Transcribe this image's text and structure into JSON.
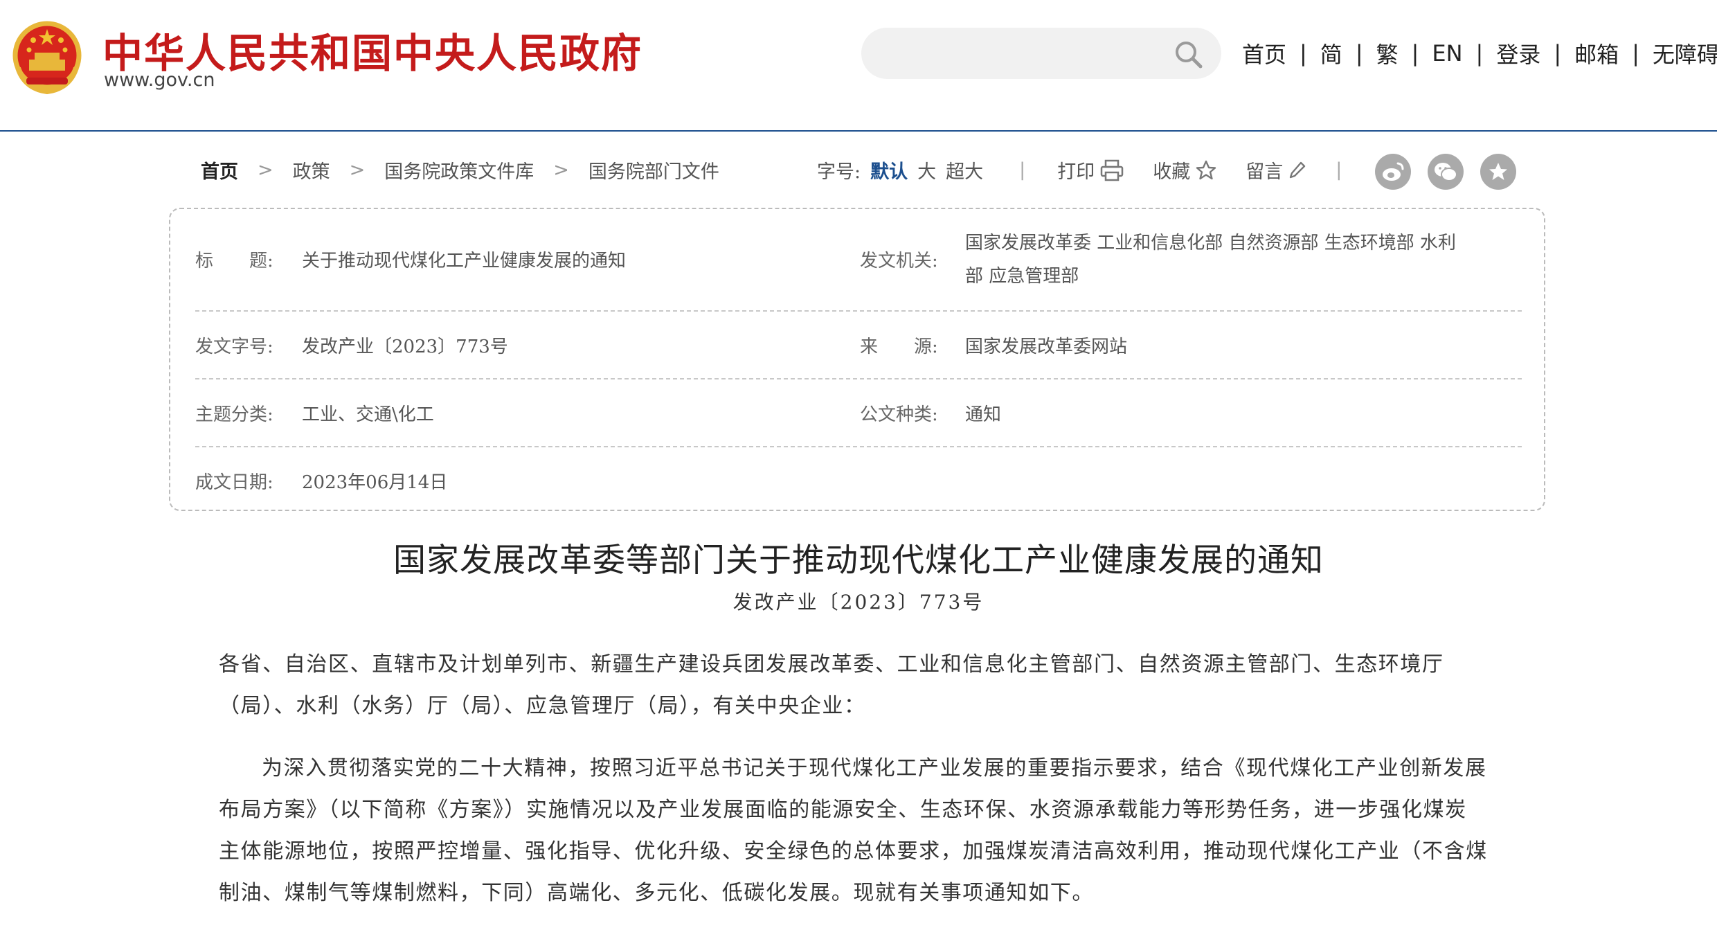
{
  "header": {
    "site_title": "中华人民共和国中央人民政府",
    "site_url": "www.gov.cn",
    "search_placeholder": "",
    "nav": [
      "首页",
      "简",
      "繁",
      "EN",
      "登录",
      "邮箱",
      "无障碍"
    ],
    "colors": {
      "brand_red": "#c41b1b",
      "accent_blue": "#1c4f8e"
    }
  },
  "breadcrumb": [
    "首页",
    "政策",
    "国务院政策文件库",
    "国务院部门文件"
  ],
  "toolbar": {
    "font_size_label": "字号:",
    "font_sizes": [
      "默认",
      "大",
      "超大"
    ],
    "selected_font_size": "默认",
    "print_label": "打印",
    "favorite_label": "收藏",
    "comment_label": "留言",
    "share_icons": [
      "weibo-icon",
      "wechat-icon",
      "star-icon"
    ]
  },
  "meta": {
    "title_label": "标　　题:",
    "title_value": "关于推动现代煤化工产业健康发展的通知",
    "issuer_label": "发文机关:",
    "issuer_line1": "国家发展改革委 工业和信息化部 自然资源部 生态环境部 水利",
    "issuer_line2": "部 应急管理部",
    "docno_label": "发文字号:",
    "docno_value": "发改产业〔2023〕773号",
    "source_label": "来　　源:",
    "source_value": "国家发展改革委网站",
    "topic_label": "主题分类:",
    "topic_value": "工业、交通\\化工",
    "doctype_label": "公文种类:",
    "doctype_value": "通知",
    "date_label": "成文日期:",
    "date_value": "2023年06月14日"
  },
  "article": {
    "title": "国家发展改革委等部门关于推动现代煤化工产业健康发展的通知",
    "doc_number": "发改产业〔2023〕773号",
    "addressee_line1": "各省、自治区、直辖市及计划单列市、新疆生产建设兵团发展改革委、工业和信息化主管部门、自然资源主管部门、生态环境厅",
    "addressee_line2": "（局）、水利（水务）厅（局）、应急管理厅（局），有关中央企业：",
    "body_line1": "为深入贯彻落实党的二十大精神，按照习近平总书记关于现代煤化工产业发展的重要指示要求，结合《现代煤化工产业创新发展",
    "body_line2": "布局方案》（以下简称《方案》）实施情况以及产业发展面临的能源安全、生态环保、水资源承载能力等形势任务，进一步强化煤炭",
    "body_line3": "主体能源地位，按照严控增量、强化指导、优化升级、安全绿色的总体要求，加强煤炭清洁高效利用，推动现代煤化工产业（不含煤",
    "body_line4": "制油、煤制气等煤制燃料，下同）高端化、多元化、低碳化发展。现就有关事项通知如下。"
  }
}
